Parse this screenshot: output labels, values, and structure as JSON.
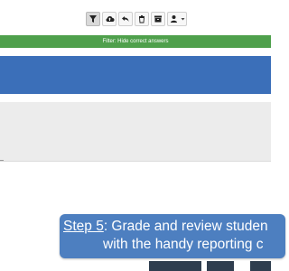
{
  "toolbar": {
    "buttons": [
      {
        "icon": "filter-icon",
        "active": true
      },
      {
        "icon": "cloud-upload-icon"
      },
      {
        "icon": "undo-icon"
      },
      {
        "icon": "trash-icon"
      },
      {
        "icon": "archive-icon"
      },
      {
        "icon": "user-icon",
        "has_dropdown": true
      }
    ]
  },
  "filter_bar": {
    "text": "Filter: Hide correct answers",
    "color": "#4fa04c"
  },
  "header_band": {
    "color": "#3b6fb9"
  },
  "caption": {
    "step": "Step 5",
    "line1_rest": ": Grade and review studen",
    "line2": "with the handy reporting c",
    "color": "#4d7fc0"
  }
}
